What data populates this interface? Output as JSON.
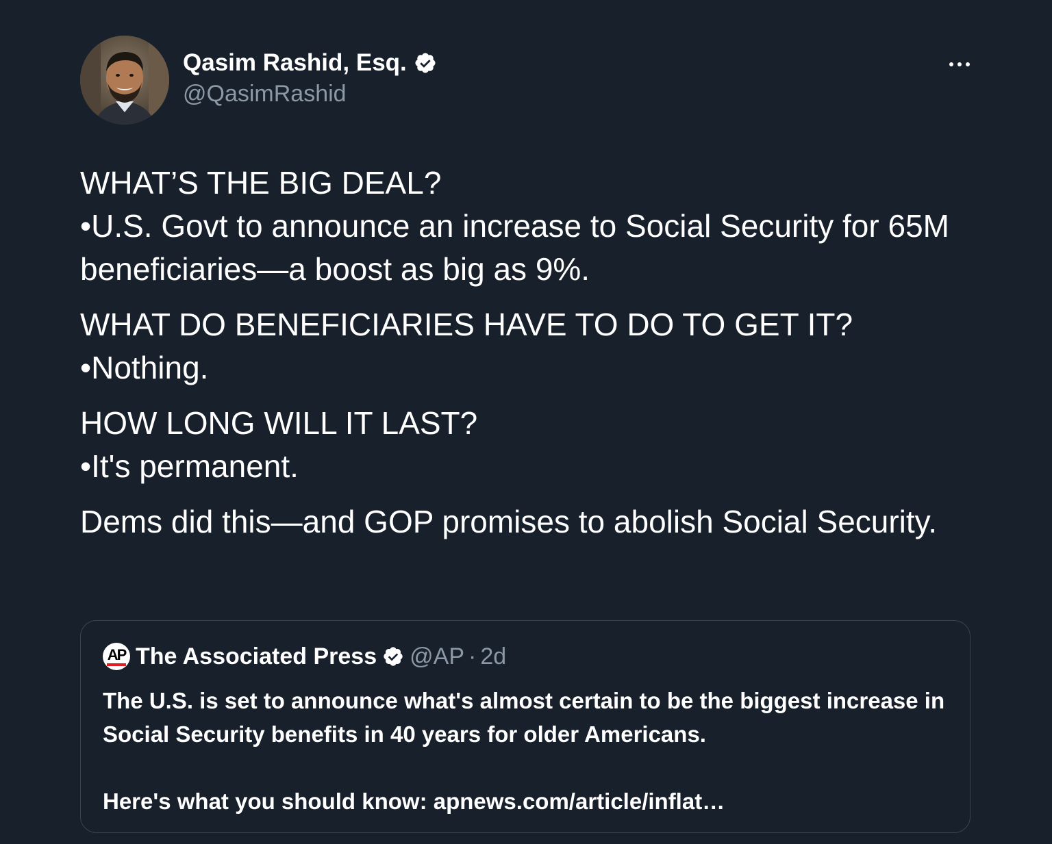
{
  "author": {
    "name": "Qasim Rashid, Esq.",
    "handle": "@QasimRashid",
    "verified": true
  },
  "tweet": {
    "paragraphs": [
      [
        "WHAT’S THE BIG DEAL?",
        "•U.S. Govt to announce an increase to Social Security for 65M beneficiaries—a boost as big as 9%."
      ],
      [
        "WHAT DO BENEFICIARIES HAVE TO DO TO GET IT?",
        "•Nothing."
      ],
      [
        "HOW LONG WILL IT LAST?",
        "•It's permanent."
      ],
      [
        "Dems did this—and GOP promises to abolish Social Security."
      ]
    ]
  },
  "quote": {
    "name": "The Associated Press",
    "handle": "@AP",
    "separator": "·",
    "time": "2d",
    "logo_text": "AP",
    "text_line_1": "The U.S. is set to announce what's almost certain to be the biggest increase in Social Security benefits in 40 years for older Americans.",
    "text_line_2": "Here's what you should know: apnews.com/article/inflat…"
  },
  "colors": {
    "background": "#18202b",
    "text": "#ffffff",
    "muted": "#8b98a5",
    "border": "#3a4450"
  },
  "icons": {
    "more": "more-horizontal-icon",
    "verified": "verified-badge-icon"
  }
}
